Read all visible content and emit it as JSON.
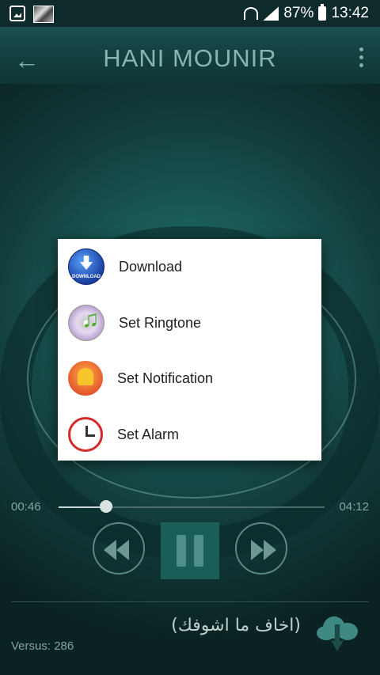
{
  "status_bar": {
    "battery": "87%",
    "time": "13:42"
  },
  "app_bar": {
    "title": "HANI MOUNIR"
  },
  "dialog": {
    "items": [
      {
        "label": "Download",
        "icon": "download-icon",
        "icon_text": "DOWNLOAD"
      },
      {
        "label": "Set Ringtone",
        "icon": "ringtone-icon"
      },
      {
        "label": "Set Notification",
        "icon": "bell-icon"
      },
      {
        "label": "Set Alarm",
        "icon": "alarm-clock-icon"
      }
    ]
  },
  "player": {
    "elapsed": "00:46",
    "duration": "04:12",
    "progress": 0.18,
    "song_title": "(اخاف ما اشوفك)",
    "versus": "Versus: 286"
  },
  "colors": {
    "accent": "#1b5e58",
    "dialog_bg": "#ffffff"
  }
}
